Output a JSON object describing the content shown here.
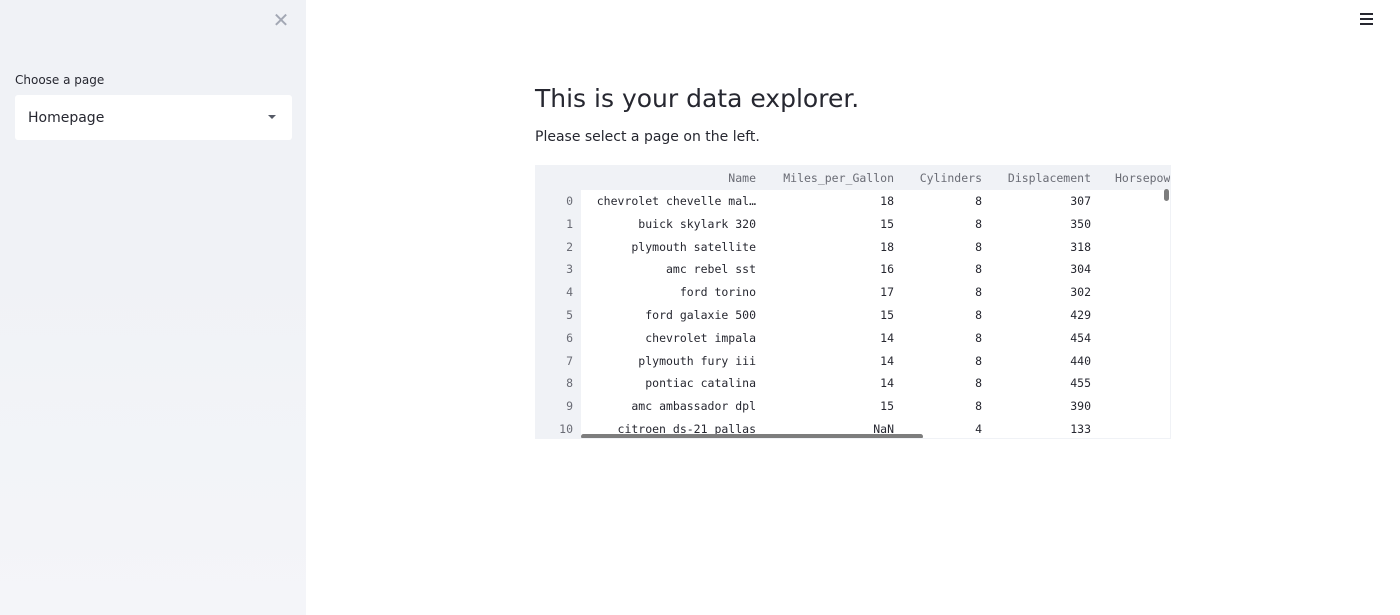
{
  "sidebar": {
    "select_label": "Choose a page",
    "selected_page": "Homepage",
    "close_icon": "close-icon",
    "caret_icon": "chevron-down-icon"
  },
  "header": {
    "menu_icon": "hamburger-menu-icon"
  },
  "main": {
    "title": "This is your data explorer.",
    "subtitle": "Please select a page on the left."
  },
  "table": {
    "columns": [
      "Name",
      "Miles_per_Gallon",
      "Cylinders",
      "Displacement",
      "Horsepow"
    ],
    "rows": [
      {
        "index": "0",
        "name": "chevrolet chevelle mal…",
        "mpg": "18",
        "cyl": "8",
        "disp": "307"
      },
      {
        "index": "1",
        "name": "buick skylark 320",
        "mpg": "15",
        "cyl": "8",
        "disp": "350"
      },
      {
        "index": "2",
        "name": "plymouth satellite",
        "mpg": "18",
        "cyl": "8",
        "disp": "318"
      },
      {
        "index": "3",
        "name": "amc rebel sst",
        "mpg": "16",
        "cyl": "8",
        "disp": "304"
      },
      {
        "index": "4",
        "name": "ford torino",
        "mpg": "17",
        "cyl": "8",
        "disp": "302"
      },
      {
        "index": "5",
        "name": "ford galaxie 500",
        "mpg": "15",
        "cyl": "8",
        "disp": "429"
      },
      {
        "index": "6",
        "name": "chevrolet impala",
        "mpg": "14",
        "cyl": "8",
        "disp": "454"
      },
      {
        "index": "7",
        "name": "plymouth fury iii",
        "mpg": "14",
        "cyl": "8",
        "disp": "440"
      },
      {
        "index": "8",
        "name": "pontiac catalina",
        "mpg": "14",
        "cyl": "8",
        "disp": "455"
      },
      {
        "index": "9",
        "name": "amc ambassador dpl",
        "mpg": "15",
        "cyl": "8",
        "disp": "390"
      },
      {
        "index": "10",
        "name": "citroen ds-21 pallas",
        "mpg": "NaN",
        "cyl": "4",
        "disp": "133"
      }
    ]
  }
}
